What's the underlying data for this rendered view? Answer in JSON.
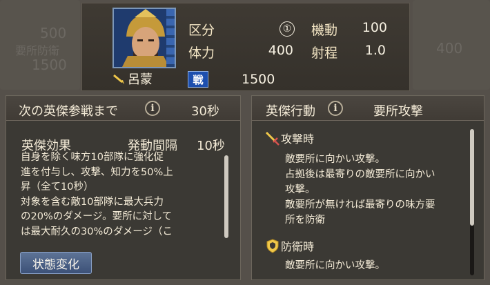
{
  "unit": {
    "name": "呂蒙",
    "war_badge": "戦",
    "troops": "1500",
    "stats": {
      "category_label": "区分",
      "category_value": "①",
      "mobility_label": "機動",
      "mobility_value": "100",
      "hp_label": "体力",
      "hp_value": "400",
      "range_label": "射程",
      "range_value": "1.0"
    }
  },
  "left_panel": {
    "next_hero_label": "次の英傑参戦まで",
    "next_hero_time": "30秒",
    "effect_label": "英傑効果",
    "interval_label": "発動間隔",
    "interval_value": "10秒",
    "effect_lines": [
      "自身を除く味方10部隊に強化促",
      "進を付与し、攻撃、知力を50%上",
      "昇（全て10秒）",
      "対象を含む敵10部隊に最大兵力",
      "の20%のダメージ。要所に対して",
      "は最大耐久の30%のダメージ（こ"
    ],
    "button_label": "状態変化"
  },
  "right_panel": {
    "action_label": "英傑行動",
    "action_value": "要所攻撃",
    "attack_trigger": "攻撃時",
    "attack_lines": [
      "敵要所に向かい攻撃。",
      "占拠後は最寄りの敵要所に向かい",
      "攻撃。",
      "敵要所が無ければ最寄りの味方要",
      "所を防衛"
    ],
    "defense_trigger": "防衛時",
    "defense_lines": [
      "敵要所に向かい攻撃。"
    ]
  },
  "info_glyph": "i",
  "backdrop": {
    "left_nums": [
      "500",
      "要所防衛",
      "1500"
    ],
    "right_num": "400"
  }
}
